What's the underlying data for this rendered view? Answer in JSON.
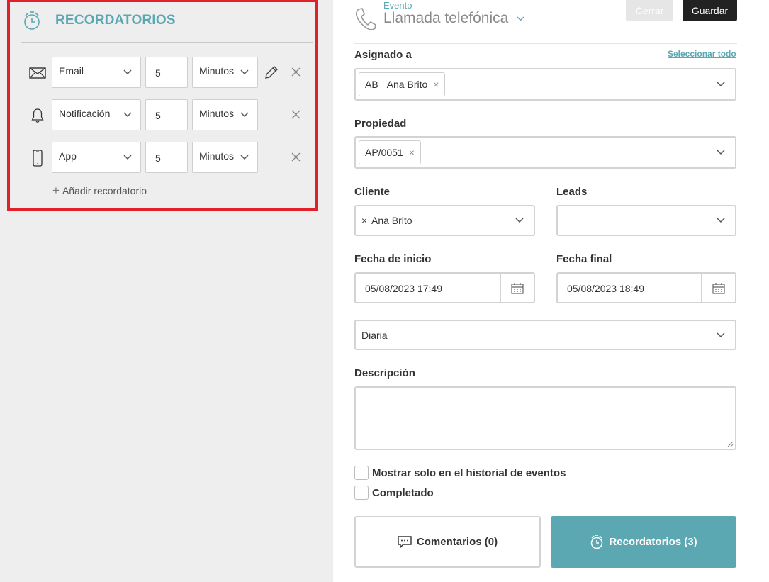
{
  "reminders_panel": {
    "title": "RECORDATORIOS",
    "header_icon": "alarm-clock-icon",
    "rows": [
      {
        "icon": "envelope-icon",
        "type": "Email",
        "amount": "5",
        "unit": "Minutos",
        "editable": true
      },
      {
        "icon": "bell-icon",
        "type": "Notificación",
        "amount": "5",
        "unit": "Minutos",
        "editable": false
      },
      {
        "icon": "smartphone-icon",
        "type": "App",
        "amount": "5",
        "unit": "Minutos",
        "editable": false
      }
    ],
    "add_label": "Añadir recordatorio"
  },
  "header": {
    "event_label": "Evento",
    "event_type": "Llamada telefónica",
    "close_label": "Cerrar",
    "save_label": "Guardar"
  },
  "form": {
    "assigned": {
      "label": "Asignado a",
      "select_all": "Seleccionar todo",
      "tag_initials": "AB",
      "tag_name": "Ana Brito"
    },
    "property": {
      "label": "Propiedad",
      "tag": "AP/0051"
    },
    "client": {
      "label": "Cliente",
      "value": "Ana Brito"
    },
    "leads": {
      "label": "Leads",
      "value": ""
    },
    "start_date": {
      "label": "Fecha de inicio",
      "value": "05/08/2023 17:49"
    },
    "end_date": {
      "label": "Fecha final",
      "value": "05/08/2023 18:49"
    },
    "recurrence": {
      "value": "Diaria"
    },
    "description": {
      "label": "Descripción",
      "value": ""
    },
    "checkboxes": [
      {
        "label": "Mostrar solo en el historial de eventos",
        "checked": false
      },
      {
        "label": "Completado",
        "checked": false
      }
    ],
    "comments_button": "Comentarios (0)",
    "reminders_button": "Recordatorios (3)"
  },
  "colors": {
    "accent": "#5ba8b3",
    "highlight_border": "#e0202a",
    "left_bg": "#eeeeee",
    "save_bg": "#222222"
  }
}
